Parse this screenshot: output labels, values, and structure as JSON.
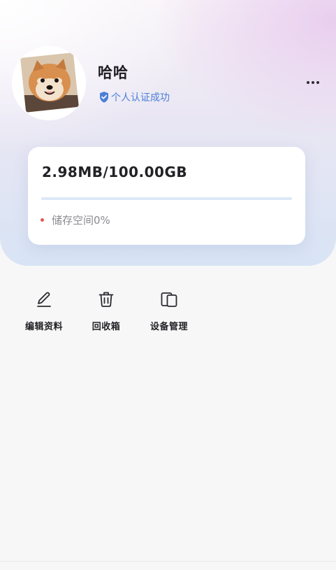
{
  "profile": {
    "username": "哈哈",
    "verified_text": "个人认证成功",
    "avatar_icon": "dog-avatar",
    "verify_icon": "shield-check-icon",
    "more_icon": "more-dots-icon"
  },
  "storage": {
    "amount": "2.98MB/100.00GB",
    "usage_percent": 0,
    "status_text": "储存空间0%",
    "status_dot_color": "#e05a5a",
    "bar_track_color": "#dde8f7"
  },
  "actions": [
    {
      "label": "编辑资料",
      "icon": "edit-pen-icon"
    },
    {
      "label": "回收箱",
      "icon": "trash-icon"
    },
    {
      "label": "设备管理",
      "icon": "devices-icon"
    }
  ],
  "colors": {
    "accent": "#4b7fd8",
    "text_primary": "#1d1d20",
    "text_secondary": "#8a8a90",
    "background": "#f7f7f8"
  }
}
